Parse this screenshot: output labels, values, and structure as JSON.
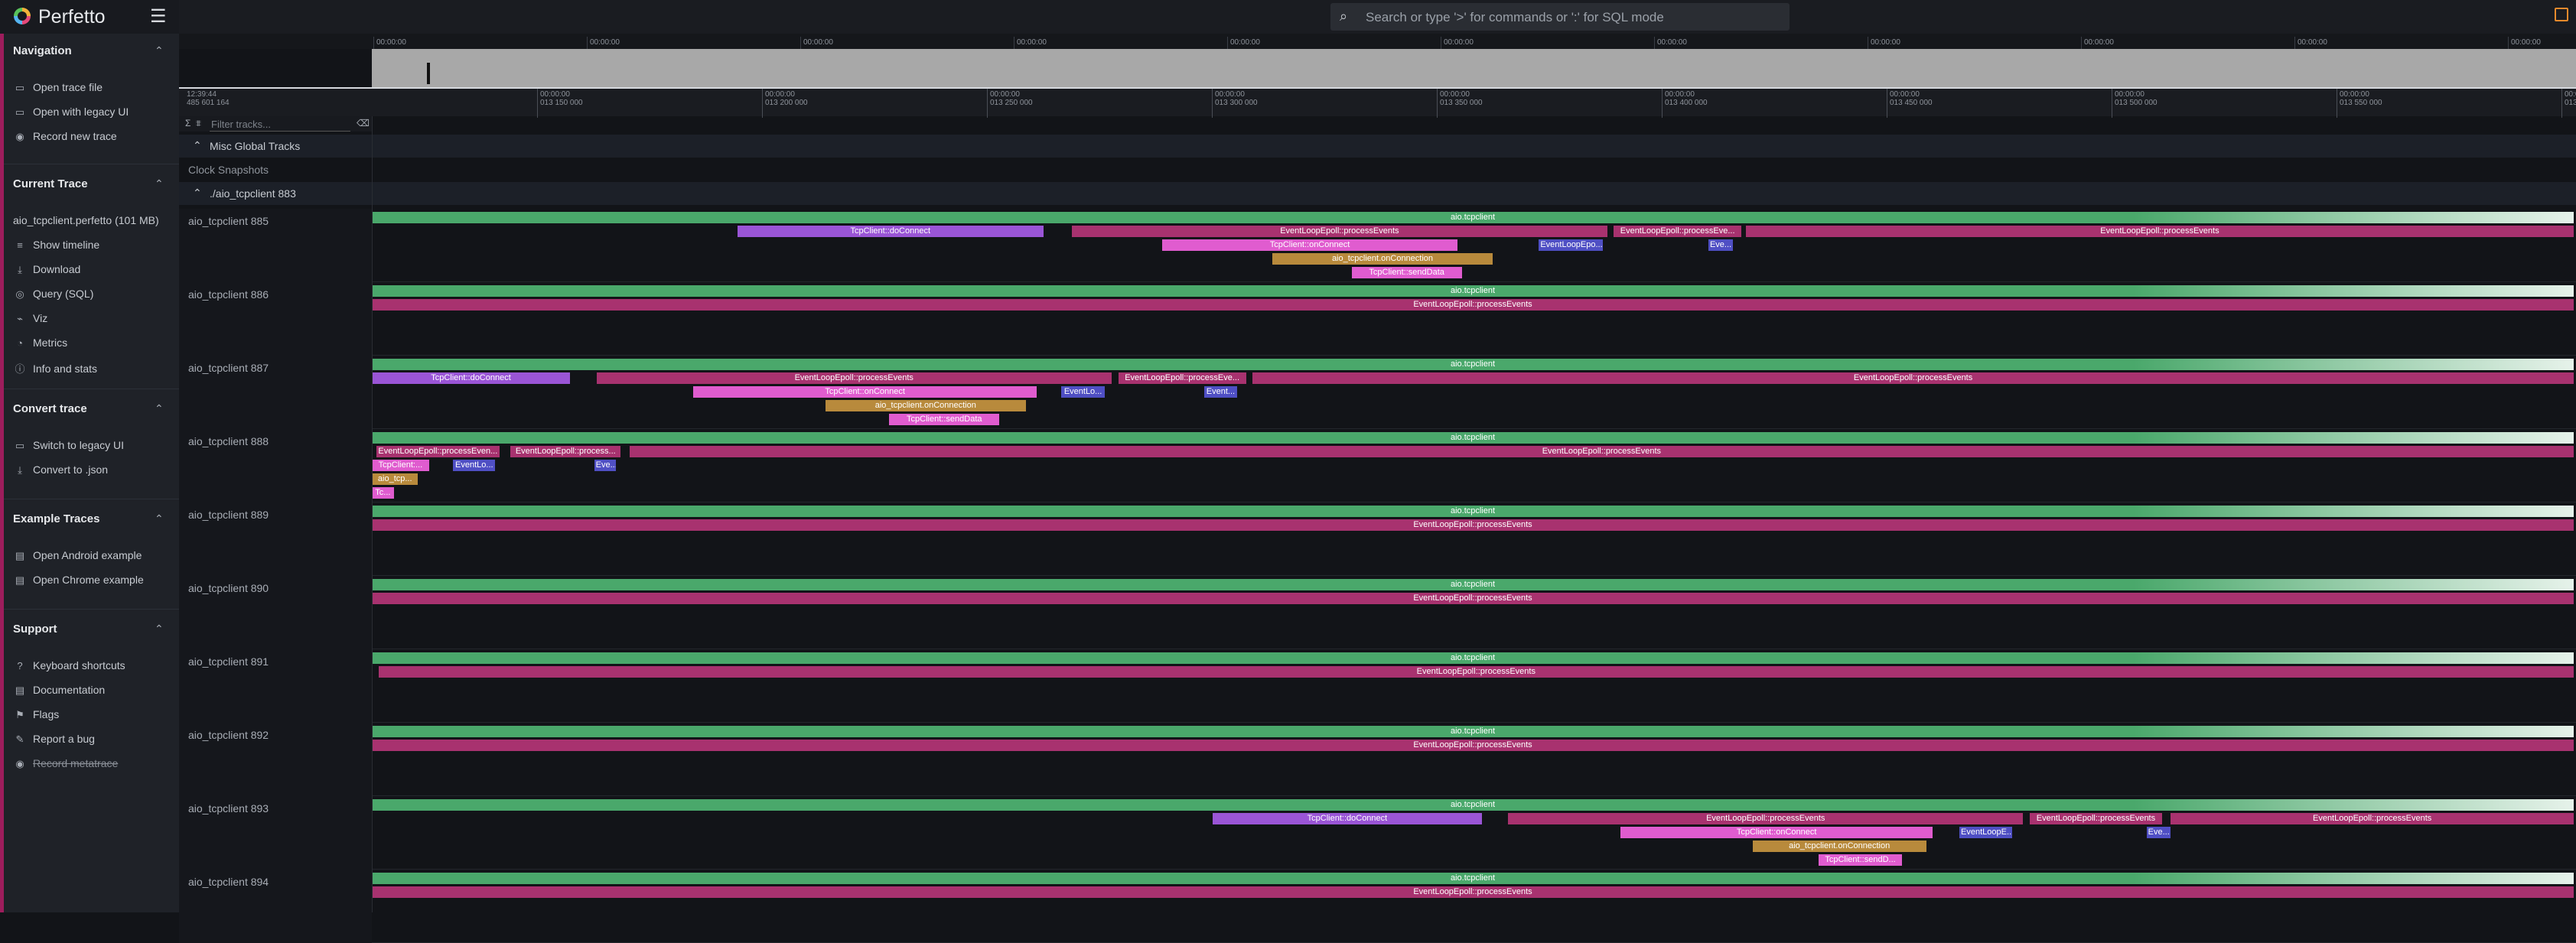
{
  "app": {
    "name": "Perfetto"
  },
  "omnibox": {
    "placeholder": "Search or type '>' for commands or ':' for SQL mode"
  },
  "sidebar": {
    "sections": [
      {
        "title": "Navigation",
        "items": [
          {
            "icon": "folder-open-icon",
            "glyph": "▭",
            "label": "Open trace file"
          },
          {
            "icon": "folder-icon",
            "glyph": "▭",
            "label": "Open with legacy UI"
          },
          {
            "icon": "record-icon",
            "glyph": "◉",
            "label": "Record new trace"
          }
        ]
      },
      {
        "title": "Current Trace",
        "items": [
          {
            "icon": "",
            "glyph": "",
            "label": "aio_tcpclient.perfetto (101 MB)"
          },
          {
            "icon": "timeline-icon",
            "glyph": "≡",
            "label": "Show timeline"
          },
          {
            "icon": "download-icon",
            "glyph": "⤓",
            "label": "Download"
          },
          {
            "icon": "query-icon",
            "glyph": "◎",
            "label": "Query (SQL)"
          },
          {
            "icon": "viz-icon",
            "glyph": "⌁",
            "label": "Viz"
          },
          {
            "icon": "metrics-icon",
            "glyph": "◔",
            "label": "Metrics"
          },
          {
            "icon": "info-icon",
            "glyph": "ⓘ",
            "label": "Info and stats"
          }
        ]
      },
      {
        "title": "Convert trace",
        "items": [
          {
            "icon": "switch-icon",
            "glyph": "▭",
            "label": "Switch to legacy UI"
          },
          {
            "icon": "convert-icon",
            "glyph": "⤓",
            "label": "Convert to .json"
          }
        ]
      },
      {
        "title": "Example Traces",
        "items": [
          {
            "icon": "description-icon",
            "glyph": "▤",
            "label": "Open Android example"
          },
          {
            "icon": "description-icon",
            "glyph": "▤",
            "label": "Open Chrome example"
          }
        ]
      },
      {
        "title": "Support",
        "items": [
          {
            "icon": "keyboard-icon",
            "glyph": "?",
            "label": "Keyboard shortcuts"
          },
          {
            "icon": "documentation-icon",
            "glyph": "▤",
            "label": "Documentation"
          },
          {
            "icon": "flag-icon",
            "glyph": "⚑",
            "label": "Flags"
          },
          {
            "icon": "bug-icon",
            "glyph": "✎",
            "label": "Report a bug"
          },
          {
            "icon": "metatrace-icon",
            "glyph": "◉",
            "label": "Record metatrace",
            "strike": true
          }
        ]
      }
    ]
  },
  "timeline": {
    "top_tick_label": "00:00:00",
    "ruler_origin": [
      "12:39:44",
      "485 601 164"
    ],
    "ruler_ticks": [
      [
        "00:00:00",
        "013 150 000"
      ],
      [
        "00:00:00",
        "013 200 000"
      ],
      [
        "00:00:00",
        "013 250 000"
      ],
      [
        "00:00:00",
        "013 300 000"
      ],
      [
        "00:00:00",
        "013 350 000"
      ],
      [
        "00:00:00",
        "013 400 000"
      ],
      [
        "00:00:00",
        "013 450 000"
      ],
      [
        "00:00:00",
        "013 500 000"
      ],
      [
        "00:00:00",
        "013 550 000"
      ],
      [
        "00:00:00",
        "013 600 000"
      ]
    ],
    "filter_placeholder": "Filter tracks..."
  },
  "tracks": {
    "misc_group": "Misc Global Tracks",
    "clock_snapshots": "Clock Snapshots",
    "process_group": "./aio_tcpclient 883",
    "threads": [
      {
        "name": "aio_tcpclient 885",
        "slices": [
          {
            "d": 0,
            "s": 0.0,
            "e": 1.0,
            "c": "green",
            "t": "aio.tcpclient"
          },
          {
            "d": 1,
            "s": 0.166,
            "e": 0.305,
            "c": "purple",
            "t": "TcpClient::doConnect"
          },
          {
            "d": 1,
            "s": 0.318,
            "e": 0.561,
            "c": "magenta",
            "t": "EventLoopEpoll::processEvents"
          },
          {
            "d": 1,
            "s": 0.564,
            "e": 0.622,
            "c": "magenta",
            "t": "EventLoopEpoll::processEve..."
          },
          {
            "d": 1,
            "s": 0.624,
            "e": 1.0,
            "c": "magenta",
            "t": "EventLoopEpoll::processEvents"
          },
          {
            "d": 2,
            "s": 0.359,
            "e": 0.493,
            "c": "pink",
            "t": "TcpClient::onConnect"
          },
          {
            "d": 2,
            "s": 0.53,
            "e": 0.559,
            "c": "blue",
            "t": "EventLoopEpo..."
          },
          {
            "d": 2,
            "s": 0.607,
            "e": 0.618,
            "c": "blue",
            "t": "Eve..."
          },
          {
            "d": 3,
            "s": 0.409,
            "e": 0.509,
            "c": "gold",
            "t": "aio_tcpclient.onConnection"
          },
          {
            "d": 4,
            "s": 0.445,
            "e": 0.495,
            "c": "pink",
            "t": "TcpClient::sendData"
          }
        ]
      },
      {
        "name": "aio_tcpclient 886",
        "slices": [
          {
            "d": 0,
            "s": 0.0,
            "e": 1.0,
            "c": "green",
            "t": "aio.tcpclient"
          },
          {
            "d": 1,
            "s": 0.0,
            "e": 1.0,
            "c": "magenta",
            "t": "EventLoopEpoll::processEvents"
          }
        ]
      },
      {
        "name": "aio_tcpclient 887",
        "slices": [
          {
            "d": 0,
            "s": 0.0,
            "e": 1.0,
            "c": "green",
            "t": "aio.tcpclient"
          },
          {
            "d": 1,
            "s": 0.0,
            "e": 0.09,
            "c": "purple",
            "t": "TcpClient::doConnect"
          },
          {
            "d": 1,
            "s": 0.102,
            "e": 0.336,
            "c": "magenta",
            "t": "EventLoopEpoll::processEvents"
          },
          {
            "d": 1,
            "s": 0.339,
            "e": 0.397,
            "c": "magenta",
            "t": "EventLoopEpoll::processEve..."
          },
          {
            "d": 1,
            "s": 0.4,
            "e": 1.0,
            "c": "magenta",
            "t": "EventLoopEpoll::processEvents"
          },
          {
            "d": 2,
            "s": 0.146,
            "e": 0.302,
            "c": "pink",
            "t": "TcpClient::onConnect"
          },
          {
            "d": 2,
            "s": 0.313,
            "e": 0.333,
            "c": "blue",
            "t": "EventLo..."
          },
          {
            "d": 2,
            "s": 0.378,
            "e": 0.393,
            "c": "blue",
            "t": "Event..."
          },
          {
            "d": 3,
            "s": 0.206,
            "e": 0.297,
            "c": "gold",
            "t": "aio_tcpclient.onConnection"
          },
          {
            "d": 4,
            "s": 0.235,
            "e": 0.285,
            "c": "pink",
            "t": "TcpClient::sendData"
          }
        ]
      },
      {
        "name": "aio_tcpclient 888",
        "slices": [
          {
            "d": 0,
            "s": 0.0,
            "e": 1.0,
            "c": "green",
            "t": "aio.tcpclient"
          },
          {
            "d": 1,
            "s": 0.002,
            "e": 0.058,
            "c": "magenta",
            "t": "EventLoopEpoll::processEven..."
          },
          {
            "d": 1,
            "s": 0.063,
            "e": 0.113,
            "c": "magenta",
            "t": "EventLoopEpoll::process..."
          },
          {
            "d": 1,
            "s": 0.117,
            "e": 1.0,
            "c": "magenta",
            "t": "EventLoopEpoll::processEvents"
          },
          {
            "d": 2,
            "s": 0.0,
            "e": 0.026,
            "c": "pink",
            "t": "TcpClient:..."
          },
          {
            "d": 2,
            "s": 0.037,
            "e": 0.056,
            "c": "blue",
            "t": "EventLo..."
          },
          {
            "d": 2,
            "s": 0.101,
            "e": 0.111,
            "c": "blue",
            "t": "Eve..."
          },
          {
            "d": 3,
            "s": 0.0,
            "e": 0.021,
            "c": "gold",
            "t": "aio_tcp..."
          },
          {
            "d": 4,
            "s": 0.0,
            "e": 0.01,
            "c": "pink",
            "t": "Tc..."
          }
        ]
      },
      {
        "name": "aio_tcpclient 889",
        "slices": [
          {
            "d": 0,
            "s": 0.0,
            "e": 1.0,
            "c": "green",
            "t": "aio.tcpclient"
          },
          {
            "d": 1,
            "s": 0.0,
            "e": 1.0,
            "c": "magenta",
            "t": "EventLoopEpoll::processEvents"
          }
        ]
      },
      {
        "name": "aio_tcpclient 890",
        "slices": [
          {
            "d": 0,
            "s": 0.0,
            "e": 1.0,
            "c": "green",
            "t": "aio.tcpclient"
          },
          {
            "d": 1,
            "s": 0.0,
            "e": 1.0,
            "c": "magenta",
            "t": "EventLoopEpoll::processEvents"
          }
        ]
      },
      {
        "name": "aio_tcpclient 891",
        "slices": [
          {
            "d": 0,
            "s": 0.0,
            "e": 1.0,
            "c": "green",
            "t": "aio.tcpclient"
          },
          {
            "d": 1,
            "s": 0.003,
            "e": 1.0,
            "c": "magenta",
            "t": "EventLoopEpoll::processEvents"
          }
        ]
      },
      {
        "name": "aio_tcpclient 892",
        "slices": [
          {
            "d": 0,
            "s": 0.0,
            "e": 1.0,
            "c": "green",
            "t": "aio.tcpclient"
          },
          {
            "d": 1,
            "s": 0.0,
            "e": 1.0,
            "c": "magenta",
            "t": "EventLoopEpoll::processEvents"
          }
        ]
      },
      {
        "name": "aio_tcpclient 893",
        "slices": [
          {
            "d": 0,
            "s": 0.0,
            "e": 1.0,
            "c": "green",
            "t": "aio.tcpclient"
          },
          {
            "d": 1,
            "s": 0.382,
            "e": 0.504,
            "c": "purple",
            "t": "TcpClient::doConnect"
          },
          {
            "d": 1,
            "s": 0.516,
            "e": 0.75,
            "c": "magenta",
            "t": "EventLoopEpoll::processEvents"
          },
          {
            "d": 1,
            "s": 0.753,
            "e": 0.813,
            "c": "magenta",
            "t": "EventLoopEpoll::processEvents"
          },
          {
            "d": 1,
            "s": 0.817,
            "e": 1.0,
            "c": "magenta",
            "t": "EventLoopEpoll::processEvents"
          },
          {
            "d": 2,
            "s": 0.567,
            "e": 0.709,
            "c": "pink",
            "t": "TcpClient::onConnect"
          },
          {
            "d": 2,
            "s": 0.721,
            "e": 0.745,
            "c": "blue",
            "t": "EventLoopE..."
          },
          {
            "d": 2,
            "s": 0.806,
            "e": 0.817,
            "c": "blue",
            "t": "Eve..."
          },
          {
            "d": 3,
            "s": 0.627,
            "e": 0.706,
            "c": "gold",
            "t": "aio_tcpclient.onConnection"
          },
          {
            "d": 4,
            "s": 0.657,
            "e": 0.695,
            "c": "pink",
            "t": "TcpClient::sendD..."
          }
        ]
      },
      {
        "name": "aio_tcpclient 894",
        "slices": [
          {
            "d": 0,
            "s": 0.0,
            "e": 1.0,
            "c": "green",
            "t": "aio.tcpclient"
          },
          {
            "d": 1,
            "s": 0.0,
            "e": 1.0,
            "c": "magenta",
            "t": "EventLoopEpoll::processEvents"
          }
        ]
      }
    ]
  },
  "colors": {
    "green": "#4aa86b",
    "purple": "#9a55d6",
    "magenta": "#a8326f",
    "pink": "#e05ccf",
    "gold": "#b88a3c",
    "blue": "#4f4fc4",
    "accent": "#9d1d5c"
  }
}
